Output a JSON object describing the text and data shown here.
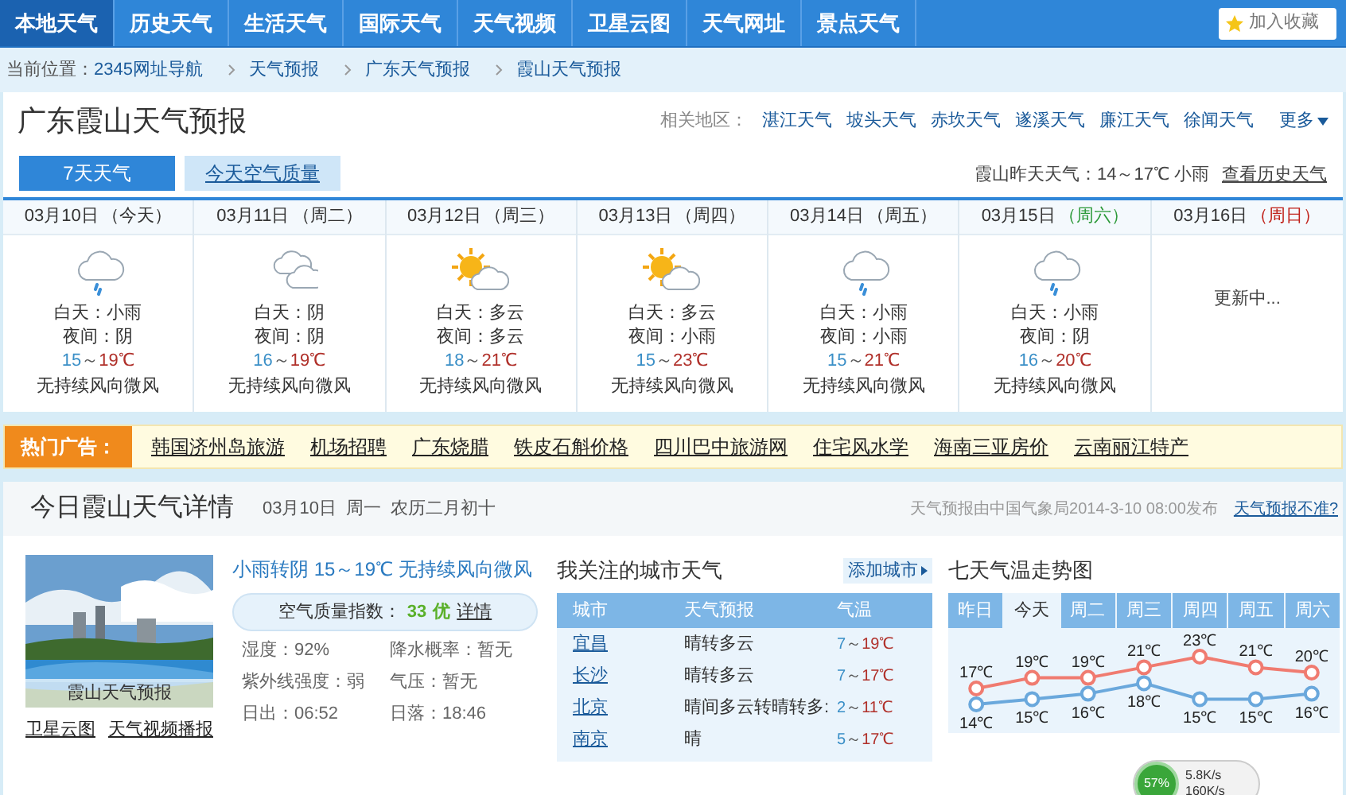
{
  "nav": {
    "items": [
      {
        "label": "本地天气",
        "selected": true
      },
      {
        "label": "历史天气",
        "selected": false
      },
      {
        "label": "生活天气",
        "selected": false
      },
      {
        "label": "国际天气",
        "selected": false
      },
      {
        "label": "天气视频",
        "selected": false
      },
      {
        "label": "卫星云图",
        "selected": false
      },
      {
        "label": "天气网址",
        "selected": false
      },
      {
        "label": "景点天气",
        "selected": false
      }
    ],
    "bookmark": "加入收藏"
  },
  "breadcrumb": {
    "label": "当前位置：",
    "items": [
      "2345网址导航",
      "天气预报",
      "广东天气预报",
      "霞山天气预报"
    ]
  },
  "header": {
    "title": "广东霞山天气预报",
    "related_label": "相关地区：",
    "related": [
      "湛江天气",
      "坡头天气",
      "赤坎天气",
      "遂溪天气",
      "廉江天气",
      "徐闻天气"
    ],
    "more": "更多"
  },
  "tabs": [
    {
      "label": "7天天气",
      "selected": true
    },
    {
      "label": "今天空气质量",
      "selected": false
    }
  ],
  "yesterday": {
    "text": "霞山昨天天气：14～17℃ 小雨",
    "link": "查看历史天气"
  },
  "days": [
    {
      "date": "03月10日",
      "weekday": "（今天）",
      "color": "#333333",
      "kind": "rain",
      "day": "白天：小雨",
      "night": "夜间：阴",
      "temp": {
        "low": "15",
        "sep": "～",
        "high": "19℃"
      },
      "wind": "无持续风向微风"
    },
    {
      "date": "03月11日",
      "weekday": "（周二）",
      "color": "#333333",
      "kind": "cloudy",
      "day": "白天：阴",
      "night": "夜间：阴",
      "temp": {
        "low": "16",
        "sep": "～",
        "high": "19℃"
      },
      "wind": "无持续风向微风"
    },
    {
      "date": "03月12日",
      "weekday": "（周三）",
      "color": "#333333",
      "kind": "partly_sunny",
      "day": "白天：多云",
      "night": "夜间：多云",
      "temp": {
        "low": "18",
        "sep": "～",
        "high": "21℃"
      },
      "wind": "无持续风向微风"
    },
    {
      "date": "03月13日",
      "weekday": "（周四）",
      "color": "#333333",
      "kind": "partly_sunny",
      "day": "白天：多云",
      "night": "夜间：小雨",
      "temp": {
        "low": "15",
        "sep": "～",
        "high": "23℃"
      },
      "wind": "无持续风向微风"
    },
    {
      "date": "03月14日",
      "weekday": "（周五）",
      "color": "#333333",
      "kind": "rain",
      "day": "白天：小雨",
      "night": "夜间：小雨",
      "temp": {
        "low": "15",
        "sep": "～",
        "high": "21℃"
      },
      "wind": "无持续风向微风"
    },
    {
      "date": "03月15日",
      "weekday": "（周六）",
      "color": "#2d9a3a",
      "kind": "rain",
      "day": "白天：小雨",
      "night": "夜间：阴",
      "temp": {
        "low": "16",
        "sep": "～",
        "high": "20℃"
      },
      "wind": "无持续风向微风"
    },
    {
      "date": "03月16日",
      "weekday": "（周日）",
      "color": "#c0221a",
      "updating": "更新中..."
    }
  ],
  "ads": {
    "label": "热门广告：",
    "links": [
      "韩国济州岛旅游",
      "机场招聘",
      "广东烧腊",
      "铁皮石斛价格",
      "四川巴中旅游网",
      "住宅风水学",
      "海南三亚房价",
      "云南丽江特产"
    ]
  },
  "detail": {
    "title": "今日霞山天气详情",
    "date": "03月10日  周一  农历二月初十",
    "source": "天气预报由中国气象局2014-3-10 08:00发布",
    "feedback": "天气预报不准?",
    "photo": {
      "kind": "picture",
      "caption": "霞山天气预报"
    },
    "photo_links": [
      "卫星云图",
      "天气视频播报"
    ],
    "summary": "小雨转阴 15～19℃ 无持续风向微风",
    "aqi": {
      "label": "空气质量指数：",
      "value": "33",
      "level": "优",
      "link": "详情"
    },
    "stats": [
      "湿度：92%",
      "降水概率：暂无",
      "紫外线强度：弱",
      "气压：暂无",
      "日出：06:52",
      "日落：18:46"
    ]
  },
  "cities": {
    "title": "我关注的城市天气",
    "add": "添加城市",
    "columns": [
      "城市",
      "天气预报",
      "气温"
    ],
    "rows": [
      {
        "city": "宜昌",
        "forecast": "晴转多云",
        "temp": {
          "low": "7",
          "sep": "～",
          "high": "19℃"
        }
      },
      {
        "city": "长沙",
        "forecast": "晴转多云",
        "temp": {
          "low": "7",
          "sep": "～",
          "high": "17℃"
        }
      },
      {
        "city": "北京",
        "forecast": "晴间多云转晴转多:",
        "temp": {
          "low": "2",
          "sep": "～",
          "high": "11℃"
        }
      },
      {
        "city": "南京",
        "forecast": "晴",
        "temp": {
          "low": "5",
          "sep": "～",
          "high": "17℃"
        }
      }
    ]
  },
  "trend": {
    "title": "七天气温走势图",
    "tabs": [
      {
        "selected": false
      },
      {
        "selected": true
      },
      {
        "selected": false
      },
      {
        "selected": false
      },
      {
        "selected": false
      },
      {
        "selected": false
      },
      {
        "selected": false
      }
    ],
    "chart_data": {
      "type": "line",
      "categories": [
        "昨日",
        "今天",
        "周二",
        "周三",
        "周四",
        "周五",
        "周六"
      ],
      "series": [
        {
          "color": "#f07b70",
          "marker": "circle",
          "values": [
            17,
            19,
            19,
            21,
            23,
            21,
            20
          ],
          "value_labels": [
            "17℃",
            "19℃",
            "19℃",
            "21℃",
            "23℃",
            "21℃",
            "20℃"
          ]
        },
        {
          "color": "#6aa8dc",
          "marker": "circle",
          "values": [
            14,
            15,
            16,
            18,
            15,
            15,
            16
          ],
          "value_labels": [
            "14℃",
            "15℃",
            "16℃",
            "18℃",
            "15℃",
            "15℃",
            "16℃"
          ]
        }
      ]
    }
  },
  "speed_widget": {
    "percent": "57%",
    "up": "5.8K/s",
    "down": "160K/s"
  }
}
